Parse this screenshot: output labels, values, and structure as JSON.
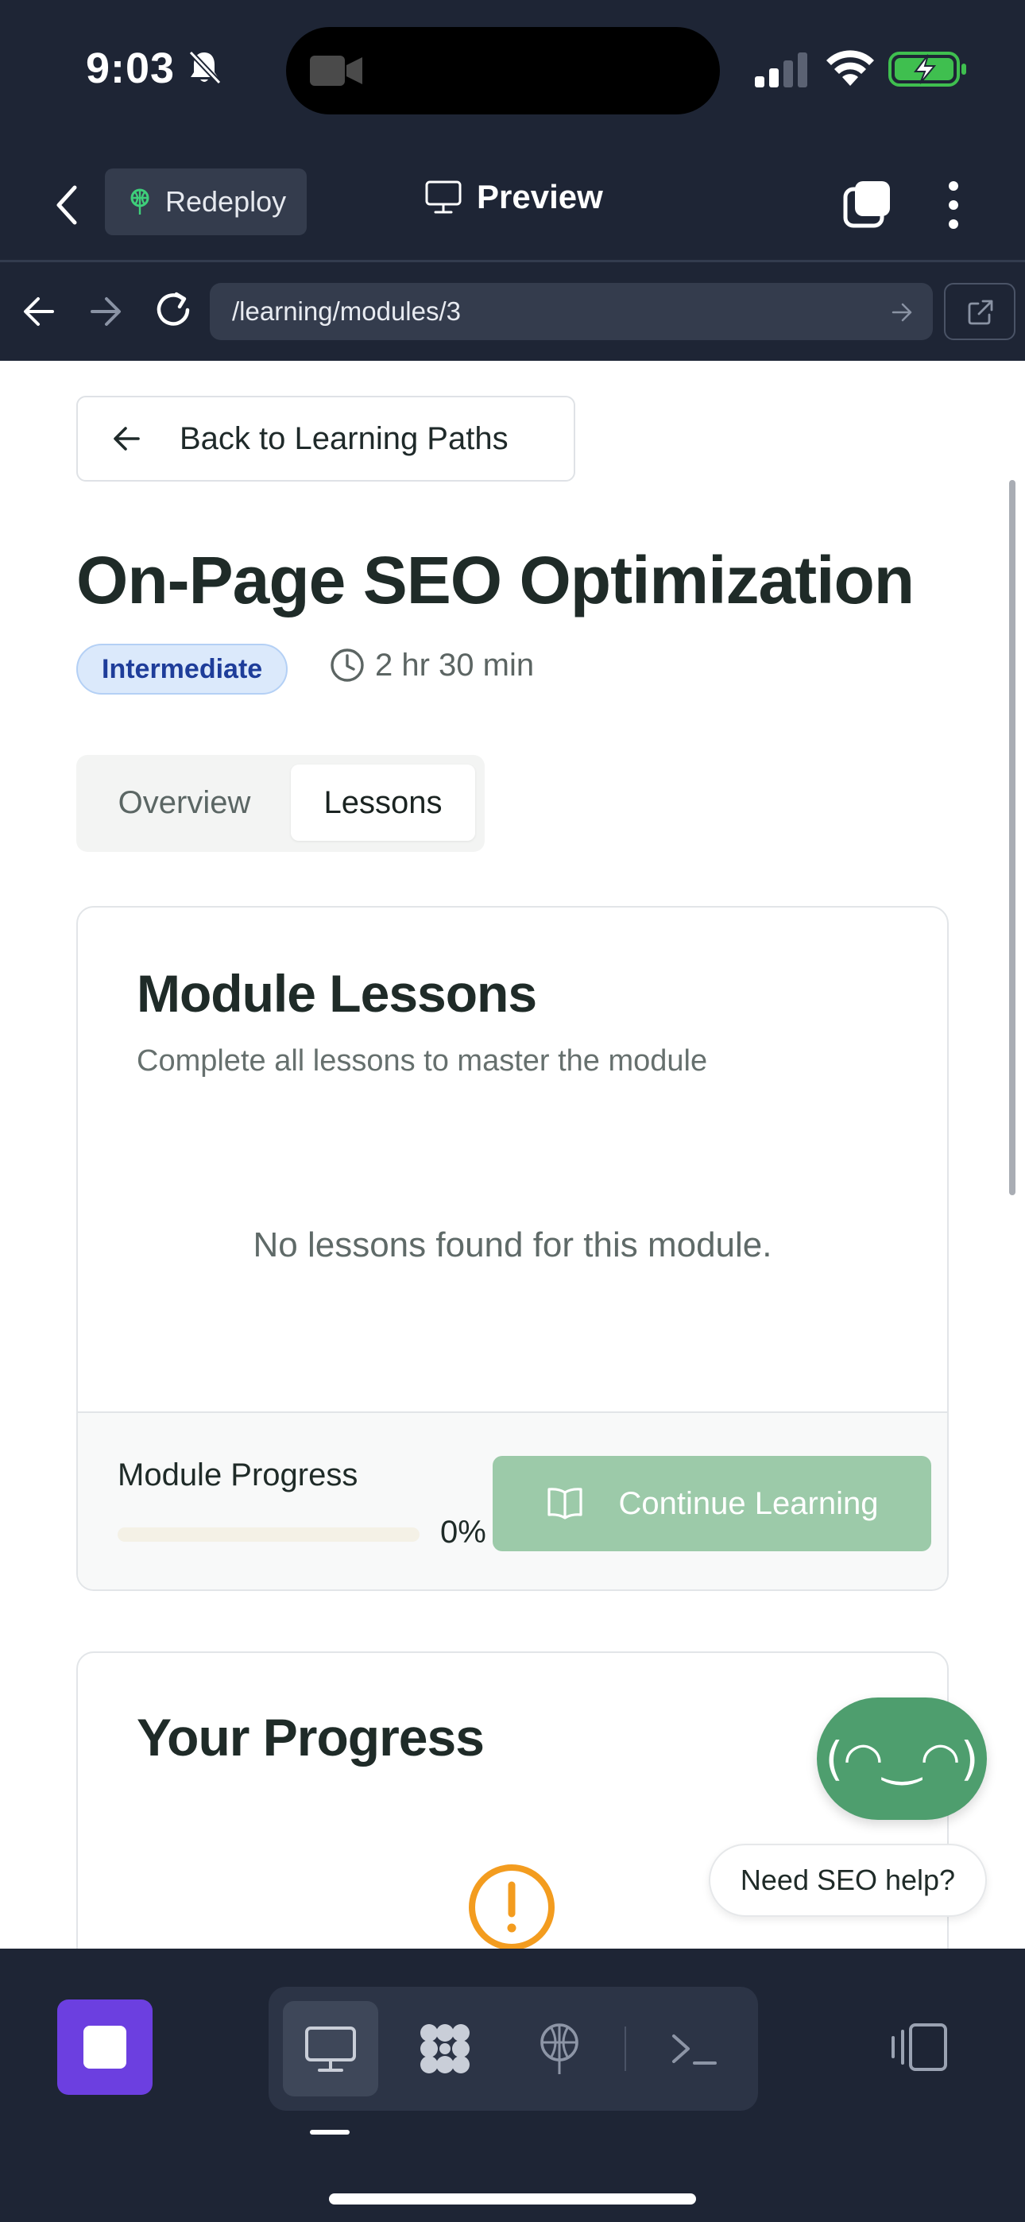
{
  "status_bar": {
    "time": "9:03"
  },
  "browser": {
    "redeploy_label": "Redeploy",
    "preview_label": "Preview",
    "url": "/learning/modules/3"
  },
  "page": {
    "back_label": "Back to Learning Paths",
    "title": "On-Page SEO Optimization",
    "level": "Intermediate",
    "duration": "2 hr 30 min",
    "tabs": [
      {
        "label": "Overview",
        "active": false
      },
      {
        "label": "Lessons",
        "active": true
      }
    ],
    "lessons_card": {
      "title": "Module Lessons",
      "subtitle": "Complete all lessons to master the module",
      "empty_message": "No lessons found for this module.",
      "progress_label": "Module Progress",
      "progress_percent": "0%",
      "progress_value": 0,
      "continue_label": "Continue Learning"
    },
    "progress_card": {
      "title": "Your Progress"
    },
    "assistant": {
      "face": "(◠‿◠)",
      "help_label": "Need SEO help?"
    }
  },
  "colors": {
    "background_dark": "#1e2535",
    "accent_green": "#4e9e6e",
    "stop_purple": "#6c3fe0",
    "badge_blue": "#dbe9fb",
    "warning_orange": "#f39c1f"
  },
  "icons": {
    "status": [
      "bell-slash-icon",
      "video-camera-icon",
      "cellular-signal-icon",
      "wifi-icon",
      "battery-charging-icon"
    ],
    "header": [
      "chevron-left-icon",
      "globe-tree-icon",
      "monitor-icon",
      "tabs-icon",
      "more-vertical-icon"
    ],
    "url_bar": [
      "arrow-left-icon",
      "arrow-right-icon",
      "reload-icon",
      "arrow-right-small-icon",
      "external-link-icon"
    ],
    "toolbar": [
      "stop-icon",
      "desktop-icon",
      "grid-icon",
      "deploy-icon",
      "terminal-icon",
      "device-toggle-icon"
    ]
  }
}
